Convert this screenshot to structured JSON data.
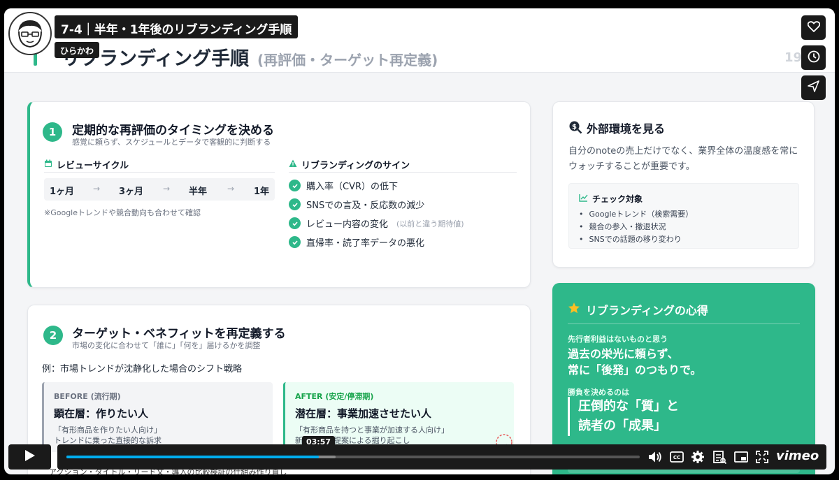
{
  "video": {
    "title": "7-4｜半年・1年後のリブランディング手順",
    "channel": "ひらかわ",
    "current_time": "03:57",
    "progress_fraction": 0.44,
    "loaded_fraction": 0.47,
    "brand": "vimeo",
    "caption": "アクション・タイトル・リード文・導入の比較検証の仕組み作り直し"
  },
  "slide": {
    "title": "リブランディング手順",
    "subtitle": "(再評価・ターゲット再定義)",
    "page_number": "19"
  },
  "card1": {
    "number": "1",
    "title": "定期的な再評価のタイミングを決める",
    "subtitle": "感覚に頼らず、スケジュールとデータで客観的に判断する",
    "cycle_label": "レビューサイクル",
    "cycle": [
      "1ヶ月",
      "3ヶ月",
      "半年",
      "1年"
    ],
    "arrow": "→",
    "cycle_note": "※Googleトレンドや競合動向も合わせて確認",
    "signs_label": "リブランディングのサイン",
    "signs": [
      {
        "text": "購入率（CVR）の低下",
        "note": ""
      },
      {
        "text": "SNSでの言及・反応数の減少",
        "note": ""
      },
      {
        "text": "レビュー内容の変化",
        "note": "(以前と違う期待値)"
      },
      {
        "text": "直帰率・読了率データの悪化",
        "note": ""
      }
    ]
  },
  "card2": {
    "number": "2",
    "title": "ターゲット・ベネフィットを再定義する",
    "subtitle": "市場の変化に合わせて「誰に」「何を」届けるかを調整",
    "example": "例：市場トレンドが沈静化した場合のシフト戦略",
    "before": {
      "label": "BEFORE (流行期)",
      "head": "顕在層：作りたい人",
      "desc1": "「有形商品を作りたい人向け」",
      "desc2": "トレンドに乗った直接的な訴求"
    },
    "after": {
      "label": "AFTER (安定/停滞期)",
      "head": "潜在層：事業加速させたい人",
      "desc1": "「有形商品を持つと事業が加速する人向け」",
      "desc2": "新たな価値提案による掘り起こし"
    }
  },
  "card3": {
    "title": "外部環境を見る",
    "desc": "自分のnoteの売上だけでなく、業界全体の温度感を常にウォッチすることが重要です。",
    "check_title": "チェック対象",
    "checks": [
      "Googleトレンド（検索需要）",
      "競合の参入・撤退状況",
      "SNSでの話題の移り変わり"
    ]
  },
  "card4": {
    "title": "リブランディングの心得",
    "label1": "先行者利益はないものと思う",
    "big1_line1": "過去の栄光に頼らず、",
    "big1_line2": "常に「後発」のつもりで。",
    "label2": "勝負を決めるのは",
    "quote_line1": "圧倒的な「質」と",
    "quote_line2": "読者の「成果」"
  },
  "colors": {
    "accent": "#2eb88a",
    "player_bg": "#1a1a1a",
    "progress": "#00adef"
  },
  "icons": [
    "heart-icon",
    "clock-icon",
    "send-icon",
    "play-icon",
    "volume-icon",
    "cc-icon",
    "gear-icon",
    "transcript-icon",
    "pip-icon",
    "fullscreen-icon",
    "calendar-icon",
    "warning-icon",
    "check-icon",
    "search-dollar-icon",
    "chart-icon",
    "star-icon"
  ]
}
